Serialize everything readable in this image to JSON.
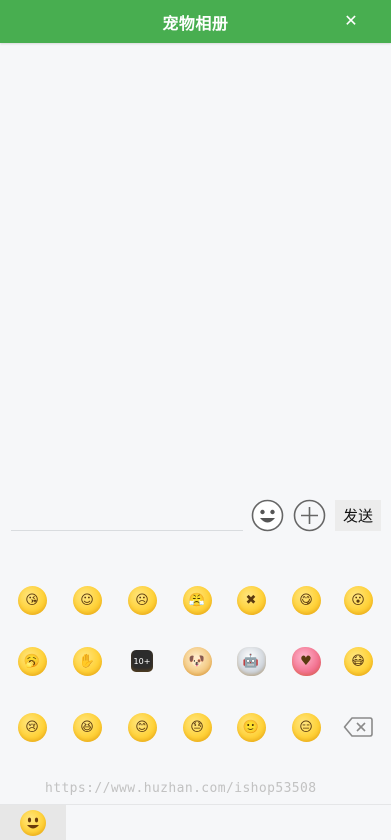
{
  "header": {
    "title": "宠物相册",
    "close_icon": "close-icon",
    "close_glyph": "✕",
    "background": "#48ae50"
  },
  "composer": {
    "input_value": "",
    "input_placeholder": "",
    "emoji_button_icon": "smiley-icon",
    "plus_button_icon": "plus-circle-icon",
    "send_label": "发送"
  },
  "emoji_panel": {
    "rows": [
      [
        {
          "name": "blow-kiss-emoji",
          "glyph": "😘",
          "style": ""
        },
        {
          "name": "shy-emoji",
          "glyph": "☺",
          "style": ""
        },
        {
          "name": "sad-emoji",
          "glyph": "☹",
          "style": ""
        },
        {
          "name": "angry-emoji",
          "glyph": "😤",
          "style": ""
        },
        {
          "name": "sealed-lips-emoji",
          "glyph": "✖",
          "style": ""
        },
        {
          "name": "tongue-emoji",
          "glyph": "😋",
          "style": ""
        },
        {
          "name": "surprised-sweat-emoji",
          "glyph": "😮",
          "style": ""
        }
      ],
      [
        {
          "name": "yawn-emoji",
          "glyph": "🥱",
          "style": ""
        },
        {
          "name": "facepalm-emoji",
          "glyph": "✋",
          "style": ""
        },
        {
          "name": "ten-plus-emoji",
          "glyph": "10+",
          "style": "dark"
        },
        {
          "name": "doge-emoji",
          "glyph": "🐶",
          "style": "dog"
        },
        {
          "name": "ultraman-emoji",
          "glyph": "🤖",
          "style": "robot"
        },
        {
          "name": "pink-blob-emoji",
          "glyph": "♥",
          "style": "pink"
        },
        {
          "name": "mask-emoji",
          "glyph": "😷",
          "style": ""
        }
      ],
      [
        {
          "name": "cry-emoji",
          "glyph": "😢",
          "style": ""
        },
        {
          "name": "laugh-emoji",
          "glyph": "😆",
          "style": ""
        },
        {
          "name": "blush-emoji",
          "glyph": "😊",
          "style": ""
        },
        {
          "name": "cold-sweat-emoji",
          "glyph": "😓",
          "style": ""
        },
        {
          "name": "smile-emoji",
          "glyph": "🙂",
          "style": ""
        },
        {
          "name": "awkward-emoji",
          "glyph": "😑",
          "style": ""
        }
      ]
    ],
    "delete_icon": "backspace-icon"
  },
  "watermark": "https://www.huzhan.com/ishop53508",
  "tab_bar": {
    "active_tab_icon": "smiley-tab-icon"
  },
  "colors": {
    "accent": "#48ae50",
    "background": "#f6f7f9",
    "send_button": "#ececec"
  }
}
